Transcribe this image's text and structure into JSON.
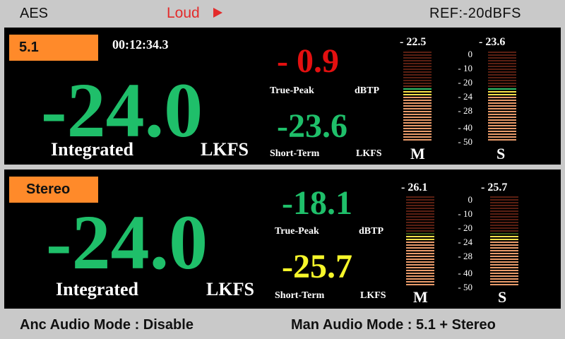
{
  "header": {
    "source": "AES",
    "mode": "Loud",
    "ref": "REF:-20dBFS"
  },
  "colors": {
    "green": "#1fbf6a",
    "red": "#e31010",
    "yellow": "#f6f62a",
    "badge": "#ff8a2a",
    "panel_bg": "#000000",
    "body_bg": "#c9c9c9"
  },
  "panels": [
    {
      "badge": "5.1",
      "timer": "00:12:34.3",
      "integrated_value": "-24.0",
      "integrated_label": "Integrated",
      "unit": "LKFS",
      "true_peak_value": "- 0.9",
      "true_peak_label": "True-Peak",
      "true_peak_unit": "dBTP",
      "short_term_value": "-23.6",
      "short_term_label": "Short-Term",
      "short_term_unit": "LKFS",
      "meter_m_top": "- 22.5",
      "meter_s_top": "- 23.6",
      "meter_m_label": "M",
      "meter_s_label": "S",
      "scale": [
        "0",
        "- 10",
        "- 20",
        "- 24",
        "- 28",
        "- 40",
        "- 50"
      ],
      "meter_m_level": -22.5,
      "meter_s_level": -23.6
    },
    {
      "badge": "Stereo",
      "integrated_value": "-24.0",
      "integrated_label": "Integrated",
      "unit": "LKFS",
      "true_peak_value": "-18.1",
      "true_peak_label": "True-Peak",
      "true_peak_unit": "dBTP",
      "short_term_value": "-25.7",
      "short_term_label": "Short-Term",
      "short_term_unit": "LKFS",
      "meter_m_top": "- 26.1",
      "meter_s_top": "- 25.7",
      "meter_m_label": "M",
      "meter_s_label": "S",
      "scale": [
        "0",
        "- 10",
        "- 20",
        "- 24",
        "- 28",
        "- 40",
        "- 50"
      ],
      "meter_m_level": -26.1,
      "meter_s_level": -25.7
    }
  ],
  "footer": {
    "anc": "Anc Audio Mode : Disable",
    "man": "Man Audio Mode : 5.1 + Stereo"
  }
}
